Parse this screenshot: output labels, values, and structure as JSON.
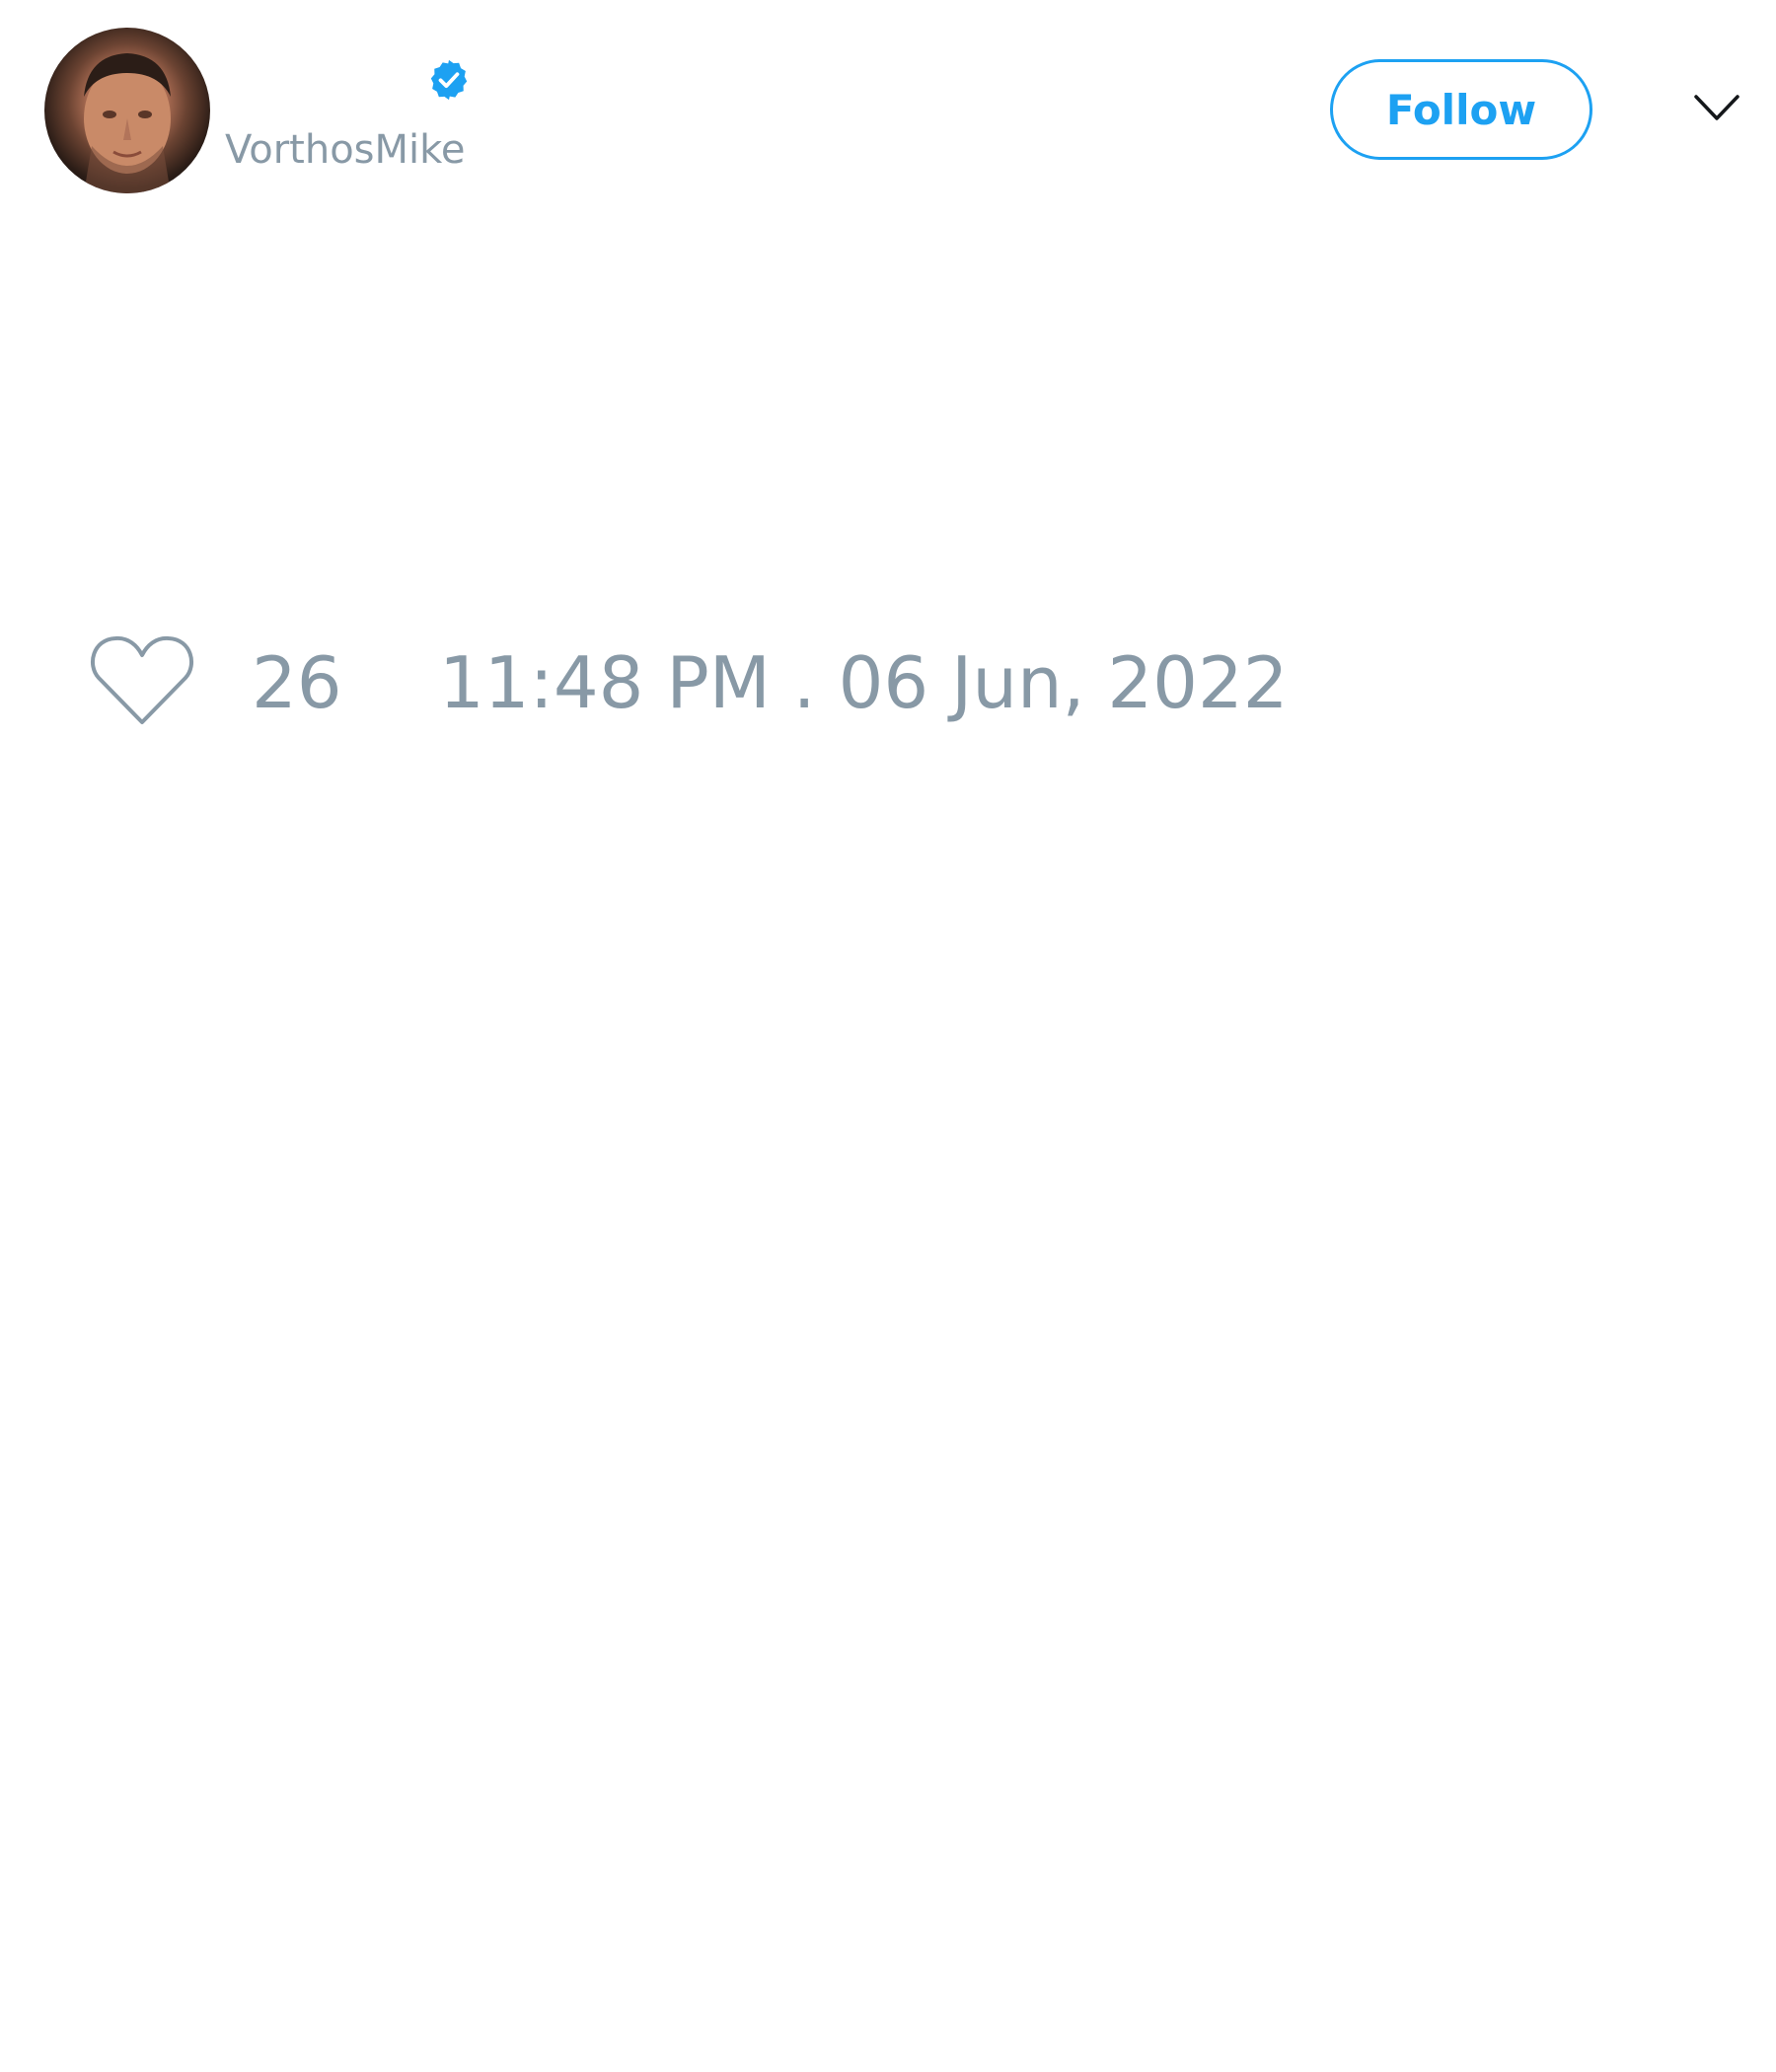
{
  "tweet": {
    "author": {
      "handle": "VorthosMike",
      "verified": true,
      "avatar": "profile-photo"
    },
    "follow_label": "Follow",
    "menu_icon": "chevron-down-icon",
    "likes": {
      "icon": "heart-icon",
      "count": "26"
    },
    "timestamp": "11:48 PM . 06 Jun, 2022"
  },
  "colors": {
    "accent": "#1da1f2",
    "muted_text": "#8899a6",
    "background": "#ffffff"
  }
}
